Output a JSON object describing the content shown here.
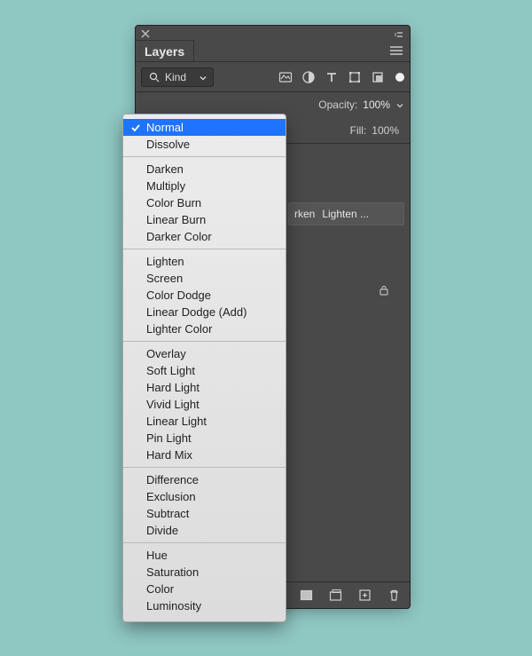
{
  "panel": {
    "title": "Layers",
    "filter": {
      "kind_label": "Kind"
    },
    "opacity": {
      "label": "Opacity:",
      "value": "100%"
    },
    "fill": {
      "label": "Fill:",
      "value": "100%"
    },
    "selected_layer": {
      "name_a": "rken",
      "name_b": "Lighten ..."
    }
  },
  "blend_modes": {
    "groups": [
      {
        "items": [
          "Normal",
          "Dissolve"
        ]
      },
      {
        "items": [
          "Darken",
          "Multiply",
          "Color Burn",
          "Linear Burn",
          "Darker Color"
        ]
      },
      {
        "items": [
          "Lighten",
          "Screen",
          "Color Dodge",
          "Linear Dodge (Add)",
          "Lighter Color"
        ]
      },
      {
        "items": [
          "Overlay",
          "Soft Light",
          "Hard Light",
          "Vivid Light",
          "Linear Light",
          "Pin Light",
          "Hard Mix"
        ]
      },
      {
        "items": [
          "Difference",
          "Exclusion",
          "Subtract",
          "Divide"
        ]
      },
      {
        "items": [
          "Hue",
          "Saturation",
          "Color",
          "Luminosity"
        ]
      }
    ],
    "selected": "Normal"
  }
}
